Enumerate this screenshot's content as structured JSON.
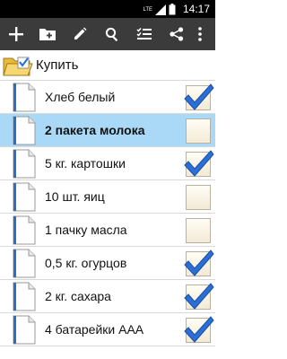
{
  "status": {
    "time": "14:17",
    "network": "LTE"
  },
  "toolbar": {
    "buttons": [
      {
        "icon": "plus-icon"
      },
      {
        "icon": "add-folder-icon"
      },
      {
        "icon": "pencil-icon"
      },
      {
        "icon": "search-icon"
      },
      {
        "icon": "checklist-icon"
      },
      {
        "icon": "share-icon"
      },
      {
        "icon": "overflow-menu-icon"
      }
    ]
  },
  "folder": {
    "label": "Купить"
  },
  "items": [
    {
      "label": "Хлеб белый",
      "checked": true,
      "selected": false
    },
    {
      "label": "2 пакета молока",
      "checked": false,
      "selected": true
    },
    {
      "label": "5 кг. картошки",
      "checked": true,
      "selected": false
    },
    {
      "label": "10 шт. яиц",
      "checked": false,
      "selected": false
    },
    {
      "label": "1 пачку масла",
      "checked": false,
      "selected": false
    },
    {
      "label": "0,5 кг. огурцов",
      "checked": true,
      "selected": false
    },
    {
      "label": "2 кг. сахара",
      "checked": true,
      "selected": false
    },
    {
      "label": "4 батарейки AAA",
      "checked": true,
      "selected": false
    }
  ]
}
